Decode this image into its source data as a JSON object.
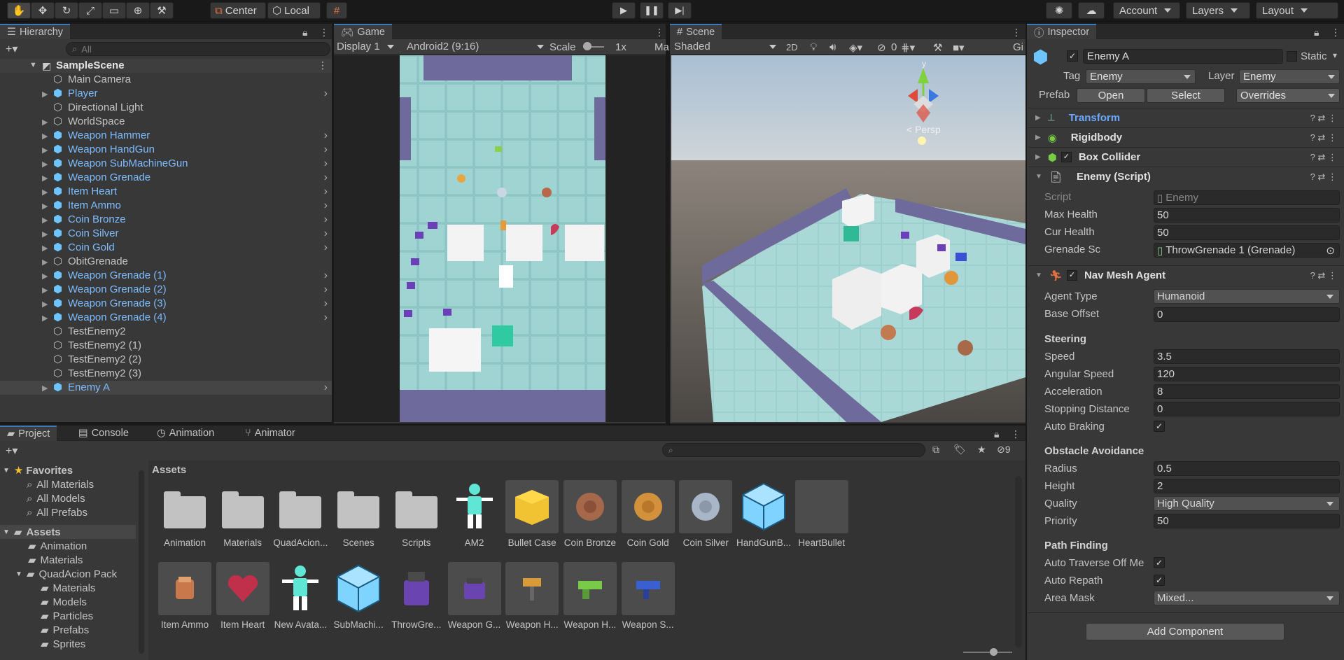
{
  "toolbar": {
    "pivot": "Center",
    "space": "Local",
    "account": "Account",
    "layers": "Layers",
    "layout": "Layout"
  },
  "hierarchy": {
    "tab": "Hierarchy",
    "search_placeholder": "All",
    "scene": "SampleScene",
    "items": [
      {
        "label": "Main Camera",
        "prefab": false,
        "expand": false,
        "chev": false
      },
      {
        "label": "Player",
        "prefab": true,
        "expand": true,
        "chev": true
      },
      {
        "label": "Directional Light",
        "prefab": false,
        "expand": false,
        "chev": false
      },
      {
        "label": "WorldSpace",
        "prefab": false,
        "expand": true,
        "chev": false
      },
      {
        "label": "Weapon Hammer",
        "prefab": true,
        "expand": true,
        "chev": true
      },
      {
        "label": "Weapon HandGun",
        "prefab": true,
        "expand": true,
        "chev": true
      },
      {
        "label": "Weapon SubMachineGun",
        "prefab": true,
        "expand": true,
        "chev": true
      },
      {
        "label": "Weapon Grenade",
        "prefab": true,
        "expand": true,
        "chev": true
      },
      {
        "label": "Item Heart",
        "prefab": true,
        "expand": true,
        "chev": true
      },
      {
        "label": "Item Ammo",
        "prefab": true,
        "expand": true,
        "chev": true
      },
      {
        "label": "Coin Bronze",
        "prefab": true,
        "expand": true,
        "chev": true
      },
      {
        "label": "Coin Silver",
        "prefab": true,
        "expand": true,
        "chev": true
      },
      {
        "label": "Coin Gold",
        "prefab": true,
        "expand": true,
        "chev": true
      },
      {
        "label": "ObitGrenade",
        "prefab": false,
        "expand": true,
        "chev": false
      },
      {
        "label": "Weapon Grenade (1)",
        "prefab": true,
        "expand": true,
        "chev": true
      },
      {
        "label": "Weapon Grenade (2)",
        "prefab": true,
        "expand": true,
        "chev": true
      },
      {
        "label": "Weapon Grenade (3)",
        "prefab": true,
        "expand": true,
        "chev": true
      },
      {
        "label": "Weapon Grenade (4)",
        "prefab": true,
        "expand": true,
        "chev": true
      },
      {
        "label": "TestEnemy2",
        "prefab": false,
        "expand": false,
        "chev": false
      },
      {
        "label": "TestEnemy2 (1)",
        "prefab": false,
        "expand": false,
        "chev": false
      },
      {
        "label": "TestEnemy2 (2)",
        "prefab": false,
        "expand": false,
        "chev": false
      },
      {
        "label": "TestEnemy2 (3)",
        "prefab": false,
        "expand": false,
        "chev": false
      },
      {
        "label": "Enemy A",
        "prefab": true,
        "expand": true,
        "chev": true,
        "selected": true
      }
    ]
  },
  "game": {
    "tab": "Game",
    "display": "Display 1",
    "resolution": "Android2 (9:16)",
    "scale_label": "Scale",
    "scale_value": "1x",
    "more": "Ma"
  },
  "scene": {
    "tab": "Scene",
    "shading": "Shaded",
    "mode_2d": "2D",
    "hidden_count": "0",
    "persp": "< Persp",
    "gizmo_axis": "y"
  },
  "inspector": {
    "tab": "Inspector",
    "object_name": "Enemy A",
    "static": "Static",
    "tag_label": "Tag",
    "tag": "Enemy",
    "layer_label": "Layer",
    "layer": "Enemy",
    "prefab_label": "Prefab",
    "open": "Open",
    "select": "Select",
    "overrides": "Overrides",
    "components": {
      "transform": "Transform",
      "rigidbody": "Rigidbody",
      "box_collider": "Box Collider",
      "enemy_script": "Enemy (Script)",
      "nav_mesh_agent": "Nav Mesh Agent"
    },
    "script": {
      "script_label": "Script",
      "script_value": "Enemy",
      "max_health_label": "Max Health",
      "max_health": "50",
      "cur_health_label": "Cur Health",
      "cur_health": "50",
      "grenade_label": "Grenade Sc",
      "grenade_value": "ThrowGrenade 1 (Grenade)"
    },
    "nav": {
      "agent_type_label": "Agent Type",
      "agent_type": "Humanoid",
      "base_offset_label": "Base Offset",
      "base_offset": "0",
      "steering": "Steering",
      "speed_label": "Speed",
      "speed": "3.5",
      "angular_label": "Angular Speed",
      "angular": "120",
      "accel_label": "Acceleration",
      "accel": "8",
      "stopping_label": "Stopping Distance",
      "stopping": "0",
      "auto_braking_label": "Auto Braking",
      "obstacle": "Obstacle Avoidance",
      "radius_label": "Radius",
      "radius": "0.5",
      "height_label": "Height",
      "height": "2",
      "quality_label": "Quality",
      "quality": "High Quality",
      "priority_label": "Priority",
      "priority": "50",
      "path": "Path Finding",
      "auto_traverse_label": "Auto Traverse Off Me",
      "auto_repath_label": "Auto Repath",
      "area_mask_label": "Area Mask",
      "area_mask": "Mixed..."
    },
    "add_component": "Add Component"
  },
  "project": {
    "tabs": [
      "Project",
      "Console",
      "Animation",
      "Animator"
    ],
    "hidden_count": "9",
    "assets_title": "Assets",
    "favorites": "Favorites",
    "fav_items": [
      "All Materials",
      "All Models",
      "All Prefabs"
    ],
    "assets_root": "Assets",
    "tree": [
      "Animation",
      "Materials",
      "QuadAcion Pack",
      "Materials",
      "Models",
      "Particles",
      "Prefabs",
      "Sprites"
    ],
    "grid": [
      {
        "label": "Animation",
        "kind": "folder"
      },
      {
        "label": "Materials",
        "kind": "folder"
      },
      {
        "label": "QuadAcion...",
        "kind": "folder"
      },
      {
        "label": "Scenes",
        "kind": "folder"
      },
      {
        "label": "Scripts",
        "kind": "folder"
      },
      {
        "label": "AM2",
        "kind": "avatar"
      },
      {
        "label": "Bullet Case",
        "kind": "bullet"
      },
      {
        "label": "Coin Bronze",
        "kind": "coin-bronze"
      },
      {
        "label": "Coin Gold",
        "kind": "coin-gold"
      },
      {
        "label": "Coin Silver",
        "kind": "coin-silver"
      },
      {
        "label": "HandGunB...",
        "kind": "cube"
      },
      {
        "label": "HeartBullet",
        "kind": "empty"
      },
      {
        "label": "Item Ammo",
        "kind": "ammo"
      },
      {
        "label": "Item Heart",
        "kind": "heart"
      },
      {
        "label": "New Avata...",
        "kind": "avatar"
      },
      {
        "label": "SubMachi...",
        "kind": "cube"
      },
      {
        "label": "ThrowGre...",
        "kind": "grenade"
      },
      {
        "label": "Weapon G...",
        "kind": "wgrenade"
      },
      {
        "label": "Weapon H...",
        "kind": "hammer"
      },
      {
        "label": "Weapon H...",
        "kind": "handgun"
      },
      {
        "label": "Weapon S...",
        "kind": "smg"
      }
    ]
  },
  "colors": {
    "prefab_blue": "#7cbcff",
    "selection_blue": "#3a79bb",
    "floor": "#8ec8c6",
    "wall": "#7a74a8"
  }
}
